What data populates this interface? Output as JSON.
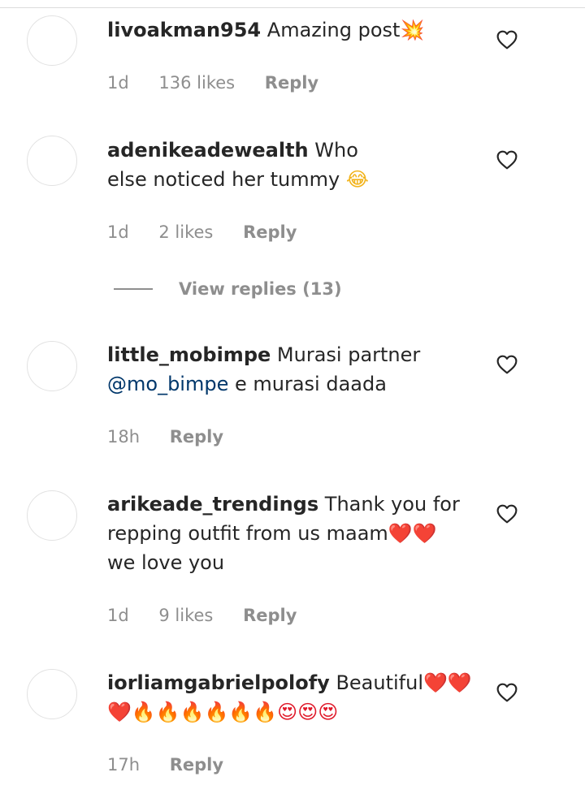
{
  "comments": [
    {
      "username": "livoakman954",
      "text": "Amazing post",
      "emoji": "💥",
      "time": "1d",
      "likes": "136 likes",
      "reply": "Reply"
    },
    {
      "username": "adenikeadewealth",
      "text": "Who else noticed her tummy",
      "emoji": "😂",
      "time": "1d",
      "likes": "2 likes",
      "reply": "Reply"
    },
    {
      "username": "little_mobimpe",
      "text": "Murasi partner",
      "mention": "@mo_bimpe",
      "text_after": "e murasi daada",
      "time": "18h",
      "reply": "Reply"
    },
    {
      "username": "arikeade_trendings",
      "text": "Thank you for repping outfit from us maam",
      "emoji": "❤️❤️",
      "text_after": "we love you",
      "time": "1d",
      "likes": "9 likes",
      "reply": "Reply"
    },
    {
      "username": "iorliamgabrielpolofy",
      "text": "Beautiful",
      "emoji": "❤️❤️❤️🔥🔥🔥🔥🔥🔥😍😍😍",
      "time": "17h",
      "reply": "Reply"
    }
  ],
  "view_replies": "View replies (13)",
  "icons": {
    "like": "heart-outline-icon",
    "avatar": "avatar-placeholder"
  },
  "colors": {
    "text": "#262626",
    "secondary": "#8e8e8e",
    "mention": "#00376b"
  }
}
